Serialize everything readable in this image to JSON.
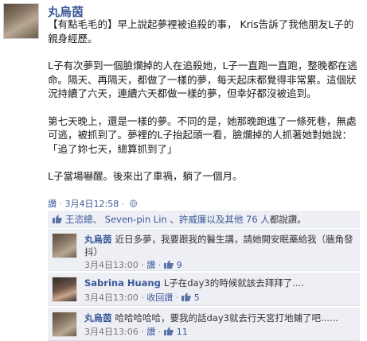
{
  "post": {
    "author": "丸烏茵",
    "paragraphs": [
      "【有點毛毛的】早上說起夢裡被追殺的事， Kris告訴了我他朋友L子的親身經歷。",
      "L子有次夢到一個臉爛掉的人在追殺她，L子一直跑一直跑，整晚都在逃命。隔天、再隔天，都做了一樣的夢，每天起床都覺得非常累。這個狀況持續了六天，連續六天都做一樣的夢，但幸好都沒被追到。",
      "第七天晚上，還是一樣的夢。不同的是，她那晚跑進了一條死巷，無處可逃，被抓到了。夢裡的L子抬起頭一看，臉爛掉的人抓著她對她說：「追了妳七天，總算抓到了」",
      "L子當場嚇醒。後來出了車禍，躺了一個月。"
    ],
    "meta": {
      "like": "讚",
      "sep": " · ",
      "timestamp": "3月4日12:58",
      "sep2": " · "
    }
  },
  "likes": {
    "names": "王恣總、 Seven-pin Lin 、許威廉以及其他",
    "others_count": "76 人",
    "suffix": "都說讚。"
  },
  "comments": [
    {
      "name": "丸烏茵",
      "text": "近日多夢，我要跟我的醫生講，請她開安眠藥給我（牆角發抖）",
      "timestamp": "3月4日13:00",
      "like": "讚",
      "likes_count": "9",
      "extra": ""
    },
    {
      "name": "Sabrina Huang",
      "text": "L子在day3的時候就該去拜拜了....",
      "timestamp": "3月4日13:00",
      "like": "",
      "likes_count": "5",
      "extra": "收回讚"
    },
    {
      "name": "丸烏茵",
      "text": "哈哈哈哈哈，要我的話day3就去行天宮打地鋪了吧......",
      "timestamp": "3月4日13:06",
      "like": "讚",
      "likes_count": "11",
      "extra": ""
    }
  ],
  "colors": {
    "link": "#3b5998",
    "comment_bg": "#edeff4"
  },
  "icons": {
    "globe": "globe-icon",
    "thumb": "thumbs-up-icon"
  }
}
